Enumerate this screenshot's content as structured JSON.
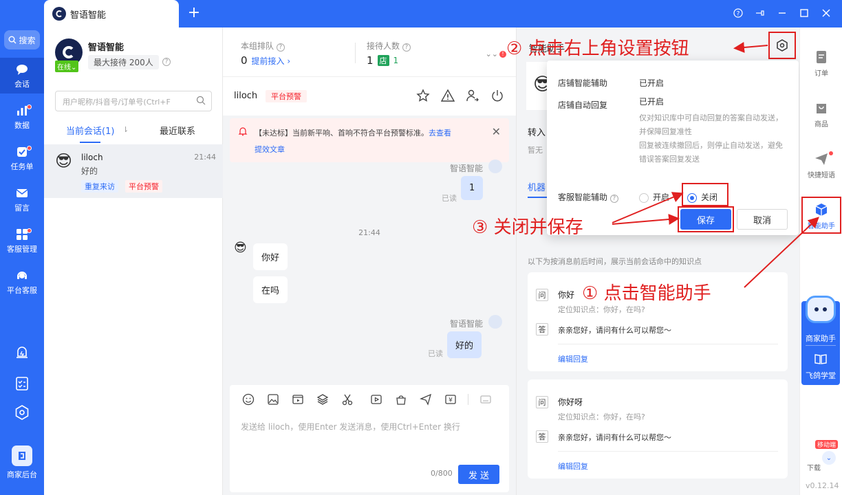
{
  "window": {
    "tab_title": "智语智能",
    "add_tab": "+"
  },
  "leftnav": {
    "search": "搜索",
    "items": [
      {
        "label": "会话"
      },
      {
        "label": "数据"
      },
      {
        "label": "任务单"
      },
      {
        "label": "留言"
      },
      {
        "label": "客服管理"
      },
      {
        "label": "平台客服"
      }
    ],
    "backend": "商家后台"
  },
  "shop": {
    "name": "智语智能",
    "status": "在线",
    "max": "最大接待 200人"
  },
  "search": {
    "placeholder": "用户昵称/抖音号/订单号(Ctrl+F"
  },
  "conv_tabs": {
    "current": "当前会话(1)",
    "recent": "最近联系"
  },
  "conversation": {
    "name": "liloch",
    "time": "21:44",
    "last": "好的",
    "tags": [
      "重复来访",
      "平台预警"
    ]
  },
  "stats": {
    "queue_label": "本组排队",
    "queue_value": "0",
    "queue_link": "提前接入",
    "reception_label": "接待人数",
    "reception_value": "1",
    "store_badge": "店",
    "store_count": "1",
    "alert_count": "!"
  },
  "chat": {
    "name": "liloch",
    "warn_tag": "平台预警",
    "alert_text": "【未达标】当前新平响、首响不符合平台预警标准。",
    "alert_link1": "去查看",
    "alert_link2": "提效文章",
    "messages": {
      "sender1": "智语智能",
      "out1": "1",
      "read1": "已读",
      "time_sep": "21:44",
      "in1": "你好",
      "in2": "在吗",
      "sender2": "智语智能",
      "out2": "好的",
      "read2": "已读"
    },
    "input_placeholder": "发送给 liloch，使用Enter 发送消息，使用Ctrl+Enter 换行",
    "counter": "0/800",
    "send": "发 送"
  },
  "assistant": {
    "title": "智能助手",
    "transfer": "转入",
    "none": "暂无",
    "tab": "机器",
    "hint": "以下为按消息前后时间，展示当前会话命中的知识点",
    "qa": [
      {
        "q": "你好",
        "loc": "定位知识点：你好，在吗?",
        "a": "亲亲您好，请问有什么可以帮您～",
        "edit": "编辑回复"
      },
      {
        "q": "你好呀",
        "loc": "定位知识点：你好，在吗?",
        "a": "亲亲您好，请问有什么可以帮您～",
        "edit": "编辑回复"
      }
    ],
    "q_badge": "问",
    "a_badge": "答"
  },
  "popup": {
    "row1_label": "店铺智能辅助",
    "row1_value": "已开启",
    "row2_label": "店铺自动回复",
    "row2_value": "已开启",
    "desc": "仅对知识库中可自动回复的答案自动发送，并保障回复准性\n回复被连续撤回后，则停止自动发送，避免错误答案回复发送",
    "assist_label": "客服智能辅助",
    "opt_on": "开启",
    "opt_off": "关闭",
    "save": "保存",
    "cancel": "取消"
  },
  "rail": {
    "items": [
      "订单",
      "商品",
      "快捷短语",
      "智能助手"
    ],
    "merchant": "商家助手",
    "academy": "飞鸽学堂",
    "mobile": "移动端",
    "download": "下载",
    "version": "v0.12.14"
  },
  "annotations": {
    "step1": "① 点击智能助手",
    "step2": "② 点击右上角设置按钮",
    "step3": "③ 关闭并保存"
  }
}
